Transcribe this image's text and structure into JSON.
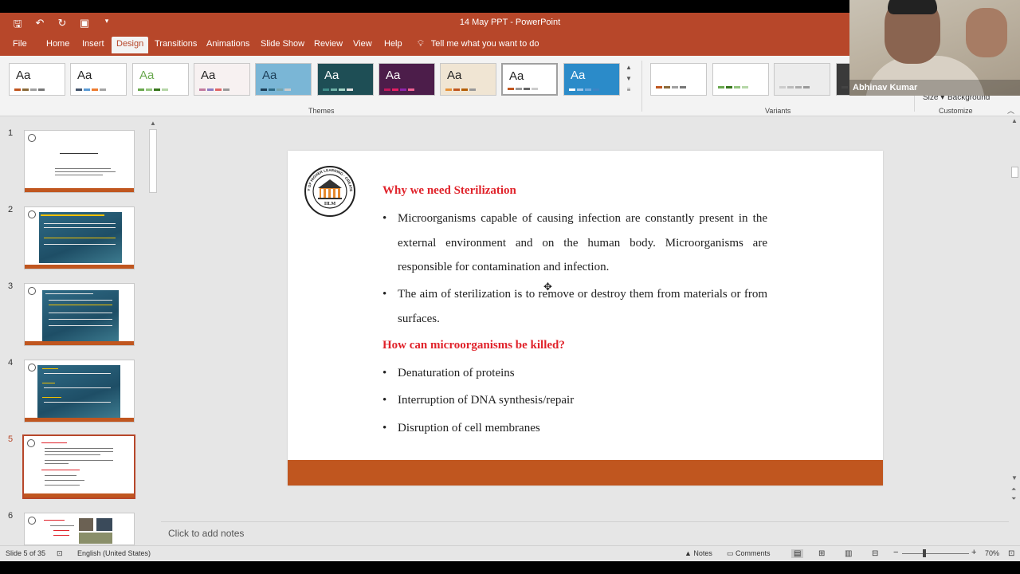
{
  "window": {
    "title": "14 May PPT  -  PowerPoint"
  },
  "qat": {
    "save_icon": "save-icon",
    "undo_icon": "undo-icon",
    "redo_icon": "redo-icon",
    "presenter_icon": "start-from-beginning-icon",
    "customize_icon": "customize-qat-icon"
  },
  "tabs": [
    "File",
    "Home",
    "Insert",
    "Design",
    "Transitions",
    "Animations",
    "Slide Show",
    "Review",
    "View",
    "Help"
  ],
  "tellme": "Tell me what you want to do",
  "ribbon": {
    "themes_label": "Themes",
    "variants_label": "Variants",
    "customize_label": "Customize",
    "size_label": "Size",
    "background_label": "Background",
    "theme_sample": "Aa",
    "themes": [
      {
        "bg": "#ffffff",
        "fg": "#222222",
        "bars": [
          "#c0561f",
          "#8a6a3a",
          "#a0a0a0",
          "#777777"
        ]
      },
      {
        "bg": "#ffffff",
        "fg": "#222222",
        "bars": [
          "#44546a",
          "#5b9bd5",
          "#ed7d31",
          "#a5a5a5"
        ]
      },
      {
        "bg": "#ffffff",
        "fg": "#6aa84f",
        "bars": [
          "#6aa84f",
          "#93c47d",
          "#38761d",
          "#b6d7a8"
        ]
      },
      {
        "bg": "#f7f1f1",
        "fg": "#222222",
        "bars": [
          "#c27ba0",
          "#8e7cc3",
          "#e06666",
          "#999999"
        ]
      },
      {
        "bg": "#7ab6d6",
        "fg": "#1d3f58",
        "bars": [
          "#1d3f58",
          "#2f6b86",
          "#76a5af",
          "#cccccc"
        ]
      },
      {
        "bg": "#1e4e55",
        "fg": "#ffffff",
        "bars": [
          "#3f8f8a",
          "#6fb3a8",
          "#a3d2c5",
          "#e0e0e0"
        ]
      },
      {
        "bg": "#4c1d4a",
        "fg": "#ffffff",
        "bars": [
          "#c2185b",
          "#e91e63",
          "#8e24aa",
          "#f06292"
        ]
      },
      {
        "bg": "#f0e5d3",
        "fg": "#222222",
        "bars": [
          "#e69138",
          "#c0561f",
          "#b45f06",
          "#999999"
        ]
      },
      {
        "bg": "#ffffff",
        "fg": "#222222",
        "bars": [
          "#c0561f",
          "#999999",
          "#666666",
          "#cccccc"
        ]
      },
      {
        "bg": "#2b8bc9",
        "fg": "#ffffff",
        "bars": [
          "#ffffff",
          "#9fc5e8",
          "#6fa8dc",
          "#3d85c6"
        ]
      }
    ],
    "variants": [
      {
        "bars": [
          "#c0561f",
          "#8a6a3a",
          "#a0a0a0",
          "#777777"
        ]
      },
      {
        "bars": [
          "#6aa84f",
          "#38761d",
          "#93c47d",
          "#b6d7a8"
        ]
      },
      {
        "bars": [
          "#cccccc",
          "#bbbbbb",
          "#aaaaaa",
          "#999999"
        ],
        "bg": "#ececec"
      },
      {
        "bars": [
          "#444444",
          "#666666",
          "#888888",
          "#aaaaaa"
        ],
        "bg": "#3a3a3a"
      }
    ]
  },
  "webcam": {
    "participant_name": "Abhinav Kumar"
  },
  "thumbnails": {
    "numbers": [
      "1",
      "2",
      "3",
      "4",
      "5",
      "6"
    ],
    "selected_index": 5
  },
  "slide": {
    "logo_text": "ACADEMY OF HIGHER LEARNING · GREATER NOIDA",
    "logo_center": "IILM",
    "heading1": "Why we need Sterilization",
    "bullets1": [
      "Microorganisms capable of causing infection are constantly present in the external environment and on the human body. Microorganisms are responsible for contamination and infection.",
      "The aim of sterilization is to remove or destroy them from materials or from surfaces."
    ],
    "heading2": "How can microorganisms be killed?",
    "bullets2": [
      "Denaturation of proteins",
      "Interruption of DNA synthesis/repair",
      "Disruption of cell membranes"
    ],
    "bullet_char": "•"
  },
  "notes": {
    "placeholder": "Click to add notes"
  },
  "status": {
    "slide_counter": "Slide 5 of 35",
    "language": "English (United States)",
    "notes_label": "Notes",
    "comments_label": "Comments",
    "zoom": "70%",
    "zoom_minus": "−",
    "zoom_plus": "+"
  }
}
